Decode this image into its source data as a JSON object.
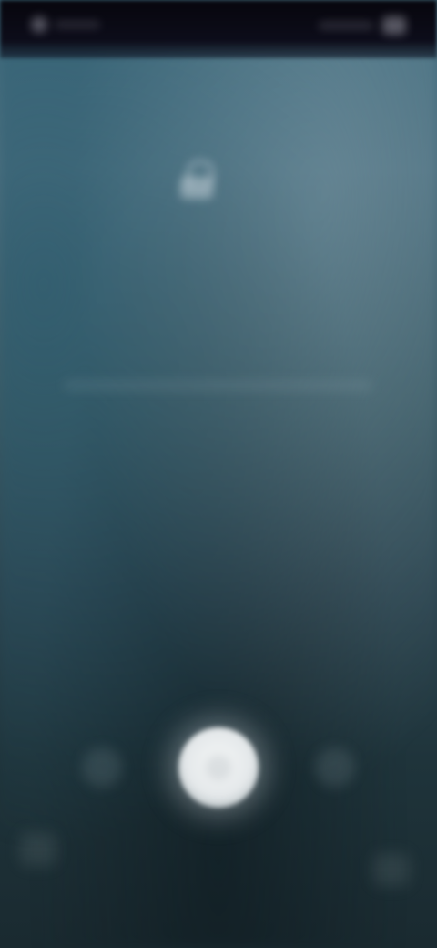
{
  "status_bar": {
    "left_text": "",
    "right_text": ""
  },
  "lock_screen": {
    "lock_icon": "lock-icon",
    "time": "",
    "date": "",
    "notification": "",
    "hint": ""
  },
  "controls": {
    "left_icon": "phone-icon",
    "center_icon": "fingerprint-icon",
    "right_icon": "camera-icon",
    "bottom_left_icon": "shortcut-icon",
    "bottom_right_icon": "shortcut-icon"
  },
  "colors": {
    "background_top": "#3f6a7c",
    "background_bottom": "#1a2a30",
    "status_bar": "#07060d",
    "center_button": "#f4f6f6"
  }
}
